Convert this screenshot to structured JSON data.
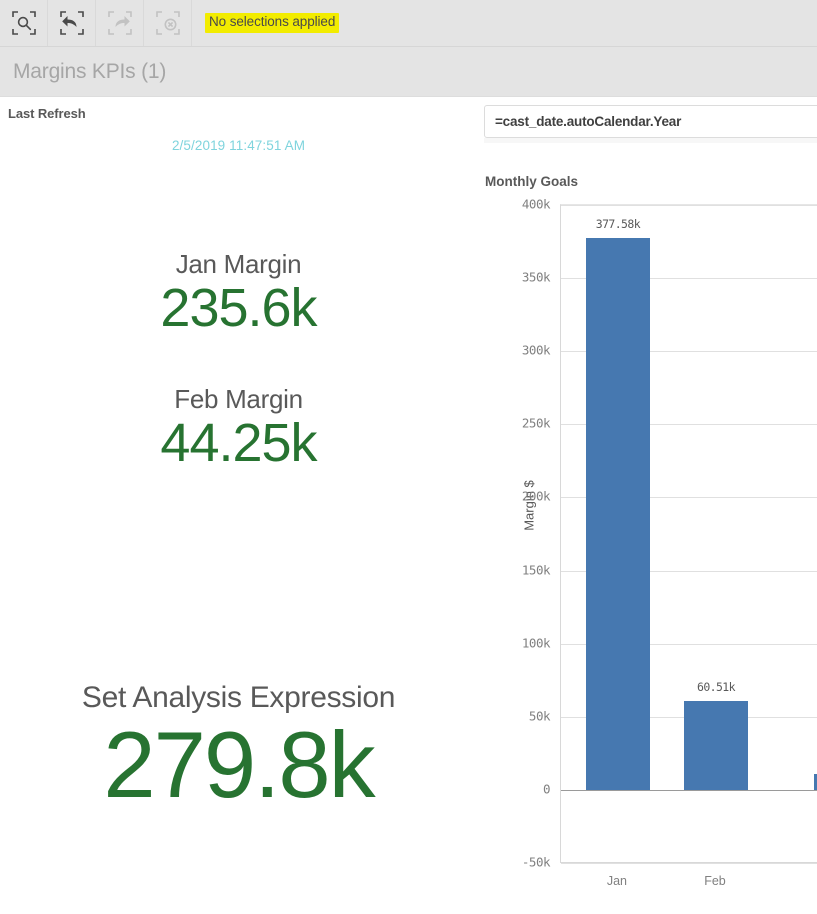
{
  "toolbar": {
    "buttons": [
      {
        "name": "selection-search-button",
        "icon": "selection-search-icon",
        "enabled": true
      },
      {
        "name": "step-back-button",
        "icon": "step-back-icon",
        "enabled": true
      },
      {
        "name": "step-forward-button",
        "icon": "step-forward-icon",
        "enabled": false
      },
      {
        "name": "clear-selections-button",
        "icon": "clear-selections-icon",
        "enabled": false
      }
    ],
    "status_text": "No selections applied",
    "status_highlight_color": "#f2ec00"
  },
  "sheet": {
    "title": "Margins KPIs (1)"
  },
  "last_refresh": {
    "title": "Last Refresh",
    "value": "2/5/2019 11:47:51 AM",
    "value_color": "#7fd4dd"
  },
  "kpis": [
    {
      "label": "Jan Margin",
      "value": "235.6k",
      "color": "#277331"
    },
    {
      "label": "Feb Margin",
      "value": "44.25k",
      "color": "#277331"
    },
    {
      "label": "Set Analysis Expression",
      "value": "279.8k",
      "color": "#277331"
    }
  ],
  "filter_pane": {
    "expression": "=cast_date.autoCalendar.Year"
  },
  "chart_data": {
    "type": "bar",
    "title": "Monthly Goals",
    "categories": [
      "Jan",
      "Feb"
    ],
    "values": [
      377580,
      60510
    ],
    "data_labels": [
      "377.58k",
      "60.51k"
    ],
    "xlabel": "",
    "ylabel": "Margin $",
    "ylim": [
      -50000,
      400000
    ],
    "yticks": [
      400000,
      350000,
      300000,
      250000,
      200000,
      150000,
      100000,
      50000,
      0,
      -50000
    ],
    "ytick_labels": [
      "400k",
      "350k",
      "300k",
      "250k",
      "200k",
      "150k",
      "100k",
      "50k",
      "0",
      "-50k"
    ],
    "bar_color": "#4678b0",
    "grid": true,
    "legend": "none"
  }
}
